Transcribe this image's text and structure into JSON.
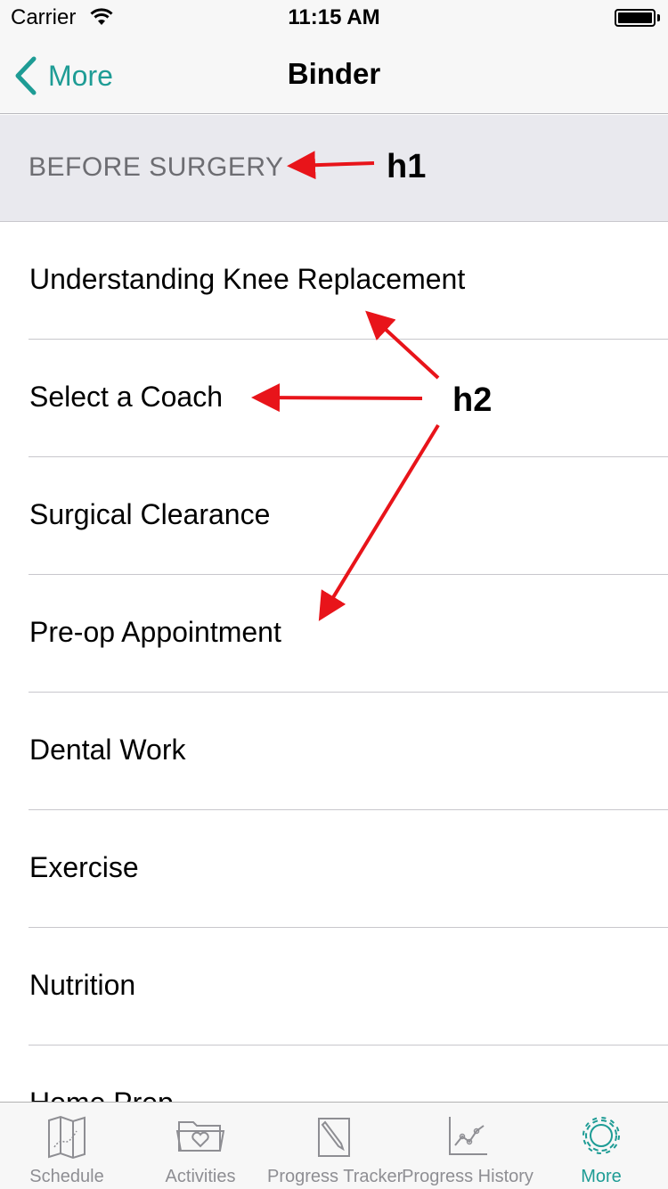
{
  "status_bar": {
    "carrier": "Carrier",
    "time": "11:15 AM"
  },
  "nav": {
    "back_label": "More",
    "title": "Binder"
  },
  "section": {
    "title": "BEFORE SURGERY"
  },
  "list_items": [
    "Understanding Knee Replacement",
    "Select a Coach",
    "Surgical Clearance",
    "Pre-op Appointment",
    "Dental Work",
    "Exercise",
    "Nutrition",
    "Home Prep"
  ],
  "annotations": {
    "h1": "h1",
    "h2": "h2",
    "arrow_color": "#e8141a"
  },
  "tabs": [
    {
      "label": "Schedule",
      "icon": "map-icon",
      "active": false
    },
    {
      "label": "Activities",
      "icon": "folder-heart-icon",
      "active": false
    },
    {
      "label": "Progress Tracker",
      "icon": "pencil-note-icon",
      "active": false
    },
    {
      "label": "Progress History",
      "icon": "line-chart-icon",
      "active": false
    },
    {
      "label": "More",
      "icon": "gear-icon",
      "active": true
    }
  ],
  "colors": {
    "accent": "#1e9c95",
    "inactive": "#8e8e93"
  }
}
